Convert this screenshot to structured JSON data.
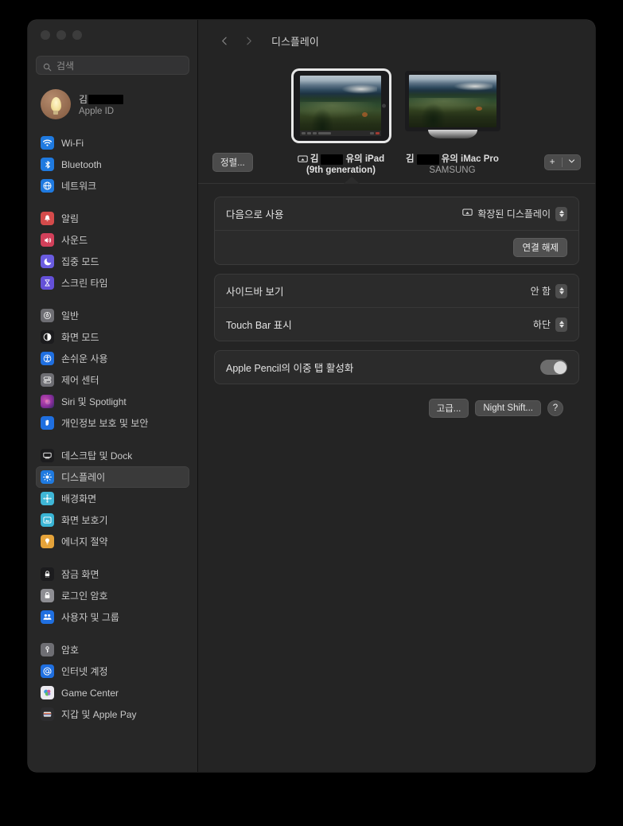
{
  "window": {
    "traffic_lights": [
      "close",
      "minimize",
      "zoom"
    ]
  },
  "sidebar": {
    "search": {
      "placeholder": "검색",
      "value": "",
      "icon": "search-icon"
    },
    "account": {
      "name_prefix": "김",
      "name_redacted": true,
      "subtitle": "Apple ID",
      "avatar_icon": "lightbulb-avatar"
    },
    "groups": [
      {
        "items": [
          {
            "label": "Wi-Fi",
            "icon": "wifi-icon",
            "color": "#1f7ae0",
            "selected": false
          },
          {
            "label": "Bluetooth",
            "icon": "bluetooth-icon",
            "color": "#1f7ae0",
            "selected": false
          },
          {
            "label": "네트워크",
            "icon": "network-globe-icon",
            "color": "#1f7ae0",
            "selected": false
          }
        ]
      },
      {
        "items": [
          {
            "label": "알림",
            "icon": "bell-icon",
            "color": "#d44b4b",
            "selected": false
          },
          {
            "label": "사운드",
            "icon": "speaker-icon",
            "color": "#d2405a",
            "selected": false
          },
          {
            "label": "집중 모드",
            "icon": "moon-icon",
            "color": "#6a5ce0",
            "selected": false
          },
          {
            "label": "스크린 타임",
            "icon": "hourglass-icon",
            "color": "#6450d8",
            "selected": false
          }
        ]
      },
      {
        "items": [
          {
            "label": "일반",
            "icon": "gear-icon",
            "color": "#6e6e73",
            "selected": false
          },
          {
            "label": "화면 모드",
            "icon": "appearance-icon",
            "color": "#1c1c1e",
            "selected": false
          },
          {
            "label": "손쉬운 사용",
            "icon": "accessibility-icon",
            "color": "#1f6fe0",
            "selected": false
          },
          {
            "label": "제어 센터",
            "icon": "control-center-icon",
            "color": "#6e6e73",
            "selected": false
          },
          {
            "label": "Siri 및 Spotlight",
            "icon": "siri-icon",
            "color": "#c0398a",
            "selected": false
          },
          {
            "label": "개인정보 보호 및 보안",
            "icon": "hand-privacy-icon",
            "color": "#1f6fe0",
            "selected": false
          }
        ]
      },
      {
        "items": [
          {
            "label": "데스크탑 및 Dock",
            "icon": "desktop-dock-icon",
            "color": "#1c1c1e",
            "selected": false
          },
          {
            "label": "디스플레이",
            "icon": "brightness-icon",
            "color": "#1f7ae0",
            "selected": true
          },
          {
            "label": "배경화면",
            "icon": "wallpaper-icon",
            "color": "#3fb6d6",
            "selected": false
          },
          {
            "label": "화면 보호기",
            "icon": "screensaver-icon",
            "color": "#39b4d4",
            "selected": false
          },
          {
            "label": "에너지 절약",
            "icon": "energy-bulb-icon",
            "color": "#e5a33a",
            "selected": false
          }
        ]
      },
      {
        "items": [
          {
            "label": "잠금 화면",
            "icon": "lock-screen-icon",
            "color": "#1c1c1e",
            "selected": false
          },
          {
            "label": "로그인 암호",
            "icon": "padlock-icon",
            "color": "#8e8e93",
            "selected": false
          },
          {
            "label": "사용자 및 그룹",
            "icon": "users-icon",
            "color": "#1f6fe0",
            "selected": false
          }
        ]
      },
      {
        "items": [
          {
            "label": "암호",
            "icon": "key-icon",
            "color": "#6e6e73",
            "selected": false
          },
          {
            "label": "인터넷 계정",
            "icon": "at-sign-icon",
            "color": "#1f6fe0",
            "selected": false
          },
          {
            "label": "Game Center",
            "icon": "game-center-icon",
            "color": "#e8e8ea",
            "selected": false
          },
          {
            "label": "지갑 및 Apple Pay",
            "icon": "wallet-icon",
            "color": "#2c2c2e",
            "selected": false
          }
        ]
      }
    ]
  },
  "main": {
    "nav": {
      "back_icon": "chevron-left-icon",
      "forward_icon": "chevron-right-icon"
    },
    "title": "디스플레이",
    "displays": [
      {
        "name_prefix": "김",
        "name_suffix": "유의 iPad",
        "name_redacted": true,
        "line2": "(9th generation)",
        "selected": true,
        "mirror_icon": "airplay-display-icon",
        "type": "ipad"
      },
      {
        "name_prefix": "김",
        "name_suffix": "유의 iMac Pro",
        "name_redacted": true,
        "line2": "SAMSUNG",
        "selected": false,
        "type": "imac"
      }
    ],
    "arrange_button": "정렬...",
    "add_button": {
      "label": "+",
      "chevron_icon": "chevron-down-icon"
    },
    "cards": [
      {
        "rows": [
          {
            "key": "다음으로 사용",
            "value": "확장된 디스플레이",
            "icon": "display-mode-icon",
            "control": "popup"
          },
          {
            "button": "연결 해제",
            "control": "button-right"
          }
        ]
      },
      {
        "rows": [
          {
            "key": "사이드바 보기",
            "value": "안 함",
            "control": "popup"
          },
          {
            "key": "Touch Bar 표시",
            "value": "하단",
            "control": "popup"
          }
        ]
      },
      {
        "rows": [
          {
            "key": "Apple Pencil의 이중 탭 활성화",
            "control": "toggle",
            "toggle_on": true
          }
        ]
      }
    ],
    "footer_buttons": [
      {
        "label": "고급...",
        "name": "advanced-button"
      },
      {
        "label": "Night Shift...",
        "name": "night-shift-button"
      }
    ],
    "help_button": "?"
  }
}
